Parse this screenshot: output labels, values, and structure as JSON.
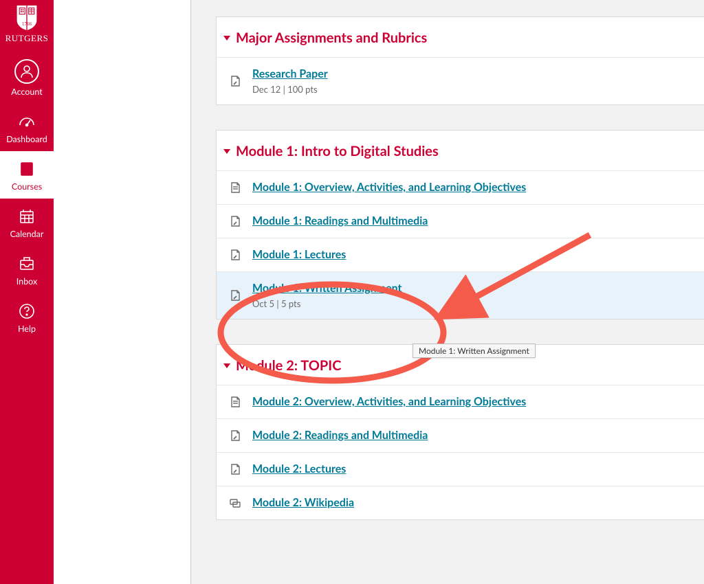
{
  "logo_text": "RUTGERS",
  "sidebar": {
    "items": [
      {
        "label": "Account"
      },
      {
        "label": "Dashboard"
      },
      {
        "label": "Courses"
      },
      {
        "label": "Calendar"
      },
      {
        "label": "Inbox"
      },
      {
        "label": "Help"
      }
    ]
  },
  "modules": [
    {
      "title": "Major Assignments and Rubrics",
      "items": [
        {
          "icon": "assignment",
          "label": "Research Paper",
          "meta": "Dec 12  |  100 pts"
        }
      ]
    },
    {
      "title": "Module 1: Intro to Digital Studies",
      "items": [
        {
          "icon": "page",
          "label": "Module 1: Overview, Activities, and Learning Objectives"
        },
        {
          "icon": "assignment",
          "label": "Module 1: Readings and Multimedia"
        },
        {
          "icon": "assignment",
          "label": "Module 1: Lectures"
        },
        {
          "icon": "assignment",
          "label": "Module 1: Written Assignment",
          "meta": "Oct 5  |  5 pts",
          "highlighted": true
        }
      ]
    },
    {
      "title": "Module 2: TOPIC",
      "items": [
        {
          "icon": "page",
          "label": "Module 2: Overview, Activities, and Learning Objectives"
        },
        {
          "icon": "assignment",
          "label": "Module 2: Readings and Multimedia"
        },
        {
          "icon": "assignment",
          "label": "Module 2: Lectures"
        },
        {
          "icon": "discussion",
          "label": "Module 2: Wikipedia"
        }
      ]
    }
  ],
  "tooltip": "Module 1: Written Assignment"
}
